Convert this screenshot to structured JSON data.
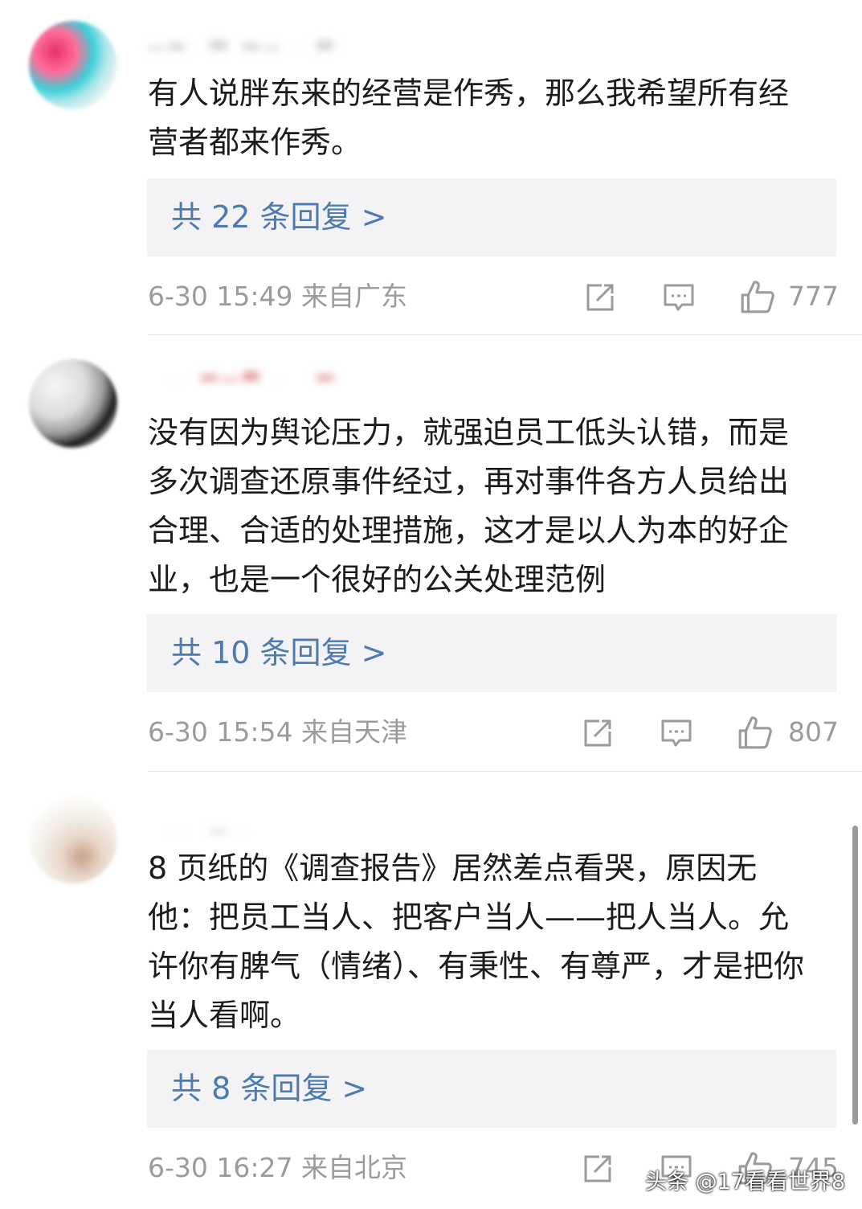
{
  "comments": [
    {
      "text": "有人说胖东来的经营是作秀，那么我希望所有经营者都来作秀。",
      "replies": "共 22 条回复 >",
      "time": "6-30 15:49 来自广东",
      "likes": "777"
    },
    {
      "text": "没有因为舆论压力，就强迫员工低头认错，而是多次调查还原事件经过，再对事件各方人员给出合理、合适的处理措施，这才是以人为本的好企业，也是一个很好的公关处理范例",
      "replies": "共 10 条回复 >",
      "time": "6-30 15:54 来自天津",
      "likes": "807"
    },
    {
      "text": "8 页纸的《调查报告》居然差点看哭，原因无他：把员工当人、把客户当人——把人当人。允许你有脾气（情绪）、有秉性、有尊严，才是把你当人看啊。",
      "replies": "共 8 条回复 >",
      "time": "6-30 16:27 来自北京",
      "likes": "745"
    }
  ],
  "icons": {
    "share": "share-icon",
    "comment": "comment-icon",
    "like": "thumbs-up-icon"
  },
  "colors": {
    "reply_link": "#4d7ab1",
    "meta_text": "#9b9b9b",
    "reply_bg": "#f3f3f5"
  },
  "watermark": "头条 @17看看世界8"
}
